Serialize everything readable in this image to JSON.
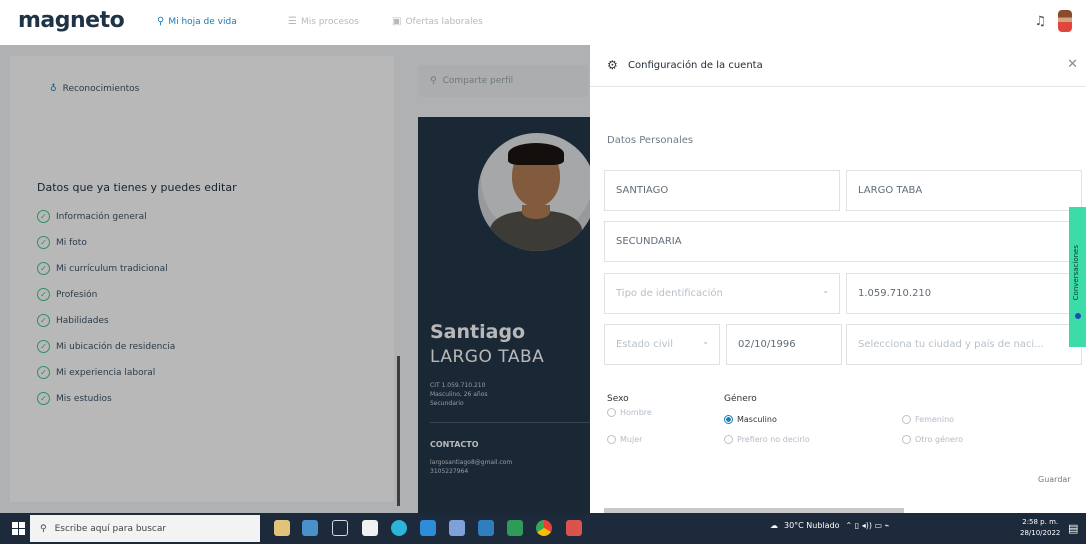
{
  "app": {
    "logo": "magneto"
  },
  "nav": {
    "items": [
      {
        "label": "Mi hoja de vida",
        "icon": "person-icon",
        "active": true
      },
      {
        "label": "Mis procesos",
        "icon": "list-icon",
        "active": false
      },
      {
        "label": "Ofertas laborales",
        "icon": "briefcase-icon",
        "active": false
      }
    ]
  },
  "left_panel": {
    "top_item": "Reconocimientos",
    "heading": "Datos que ya tienes y puedes editar",
    "items": [
      "Información general",
      "Mi foto",
      "Mi currículum tradicional",
      "Profesión",
      "Habilidades",
      "Mi ubicación de residencia",
      "Mi experiencia laboral",
      "Mis estudios"
    ]
  },
  "search": {
    "placeholder": "Comparte perfil"
  },
  "cv": {
    "first_name": "Santiago",
    "last_name": "LARGO TABA",
    "meta_line1": "CIT 1.059.710.210",
    "meta_line2": "Masculino, 26 años",
    "meta_line3": "Secundario",
    "contact_label": "CONTACTO",
    "email": "largosantiago8@gmail.com",
    "phone": "3105227964"
  },
  "modal": {
    "title": "Configuración de la cuenta",
    "section": "Datos Personales",
    "fields": {
      "first_name": "SANTIAGO",
      "last_name": "LARGO TABA",
      "education": "SECUNDARIA",
      "id_type_placeholder": "Tipo de identificación",
      "id_number": "1.059.710.210",
      "civil_status_placeholder": "Estado civil",
      "birth_date": "02/10/1996",
      "city_placeholder": "Selecciona tu ciudad y país de naci..."
    },
    "sexo": {
      "label": "Sexo",
      "options": [
        "Hombre",
        "Mujer"
      ]
    },
    "genero": {
      "label": "Género",
      "options": [
        "Masculino",
        "Prefiero no decirlo",
        "Femenino",
        "Otro género"
      ],
      "selected": "Masculino"
    },
    "save_label": "Guardar",
    "chat_tab": "Conversaciones"
  },
  "taskbar": {
    "search_placeholder": "Escribe aquí para buscar",
    "weather": "30°C  Nublado",
    "time": "2:58 p. m.",
    "date": "28/10/2022"
  }
}
